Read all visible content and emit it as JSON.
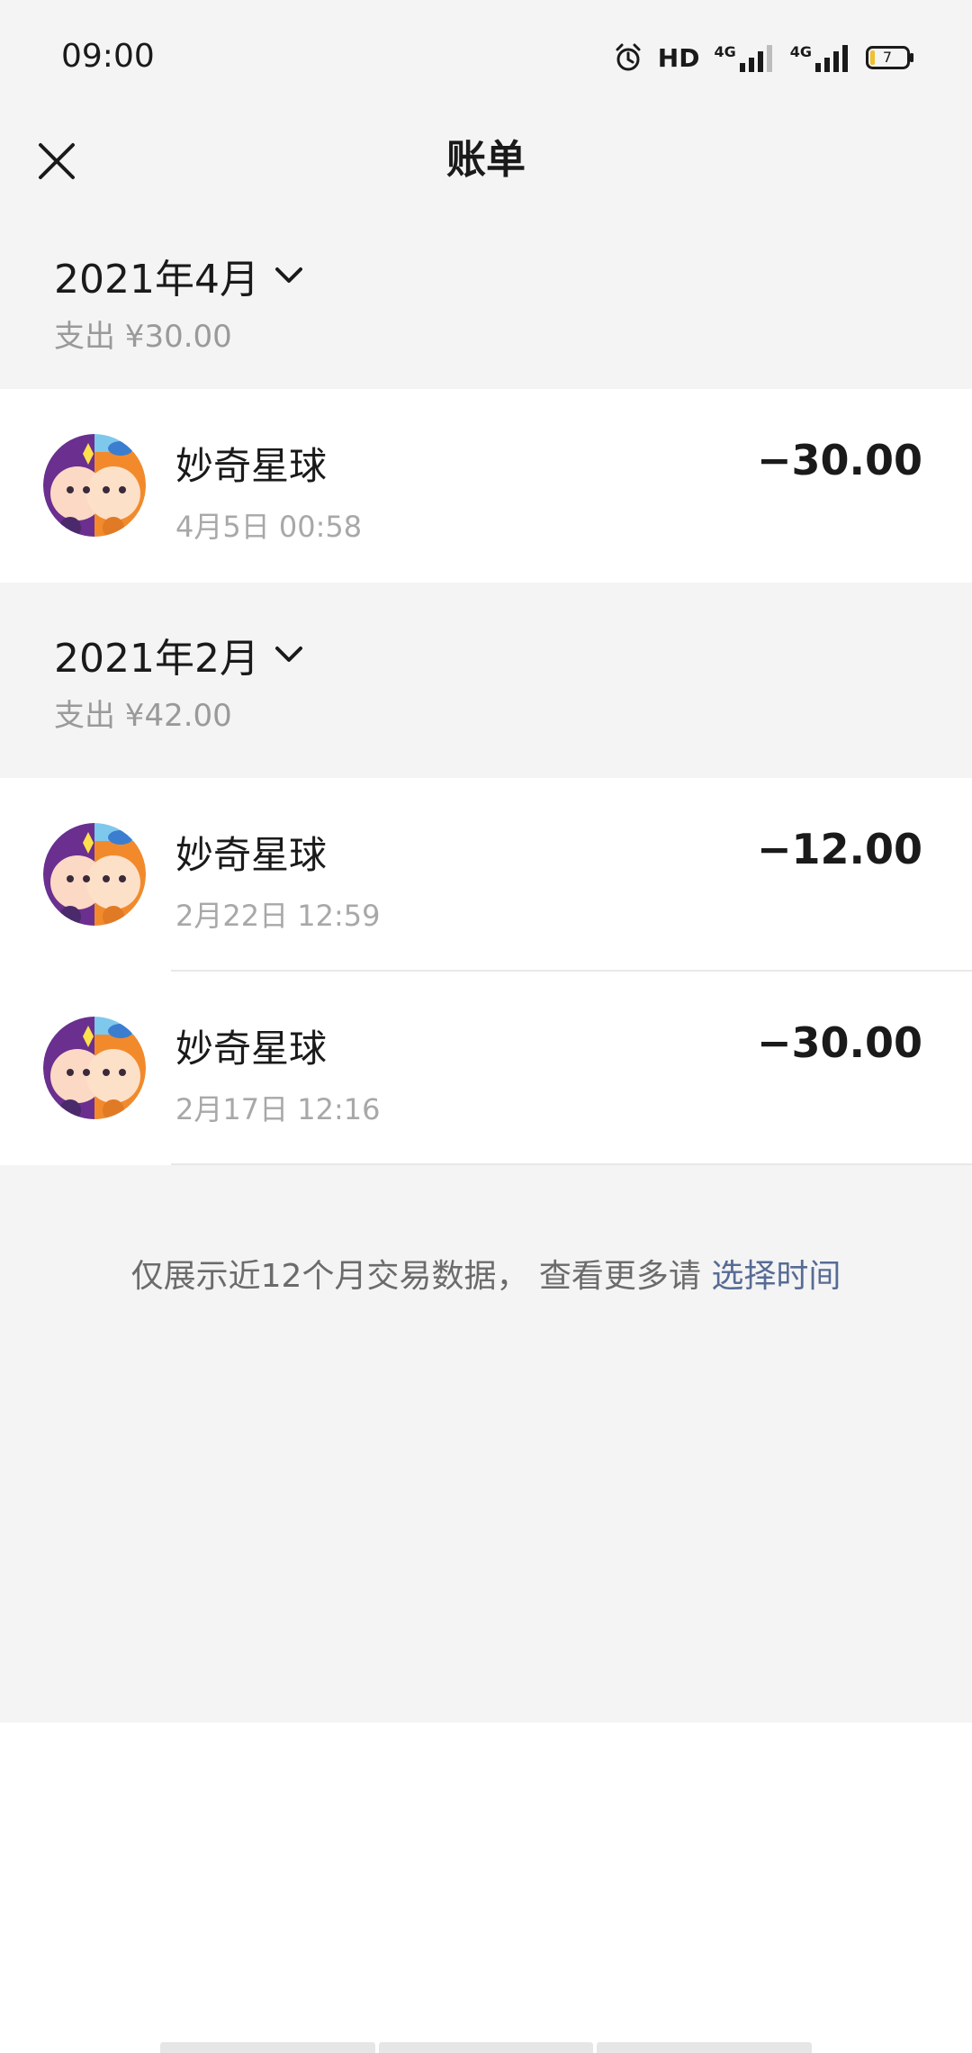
{
  "status_bar": {
    "time": "09:00",
    "network_hd": "HD",
    "network_1": "4G",
    "network_2": "4G",
    "battery": "7"
  },
  "nav": {
    "title": "账单"
  },
  "months": [
    {
      "title": "2021年4月",
      "summary": "支出 ¥30.00",
      "transactions": [
        {
          "name": "妙奇星球",
          "time": "4月5日 00:58",
          "amount": "−30.00"
        }
      ]
    },
    {
      "title": "2021年2月",
      "summary": "支出 ¥42.00",
      "transactions": [
        {
          "name": "妙奇星球",
          "time": "2月22日 12:59",
          "amount": "−12.00"
        },
        {
          "name": "妙奇星球",
          "time": "2月17日 12:16",
          "amount": "−30.00"
        }
      ]
    }
  ],
  "footer": {
    "note": "仅展示近12个月交易数据， 查看更多请 ",
    "link": "选择时间"
  },
  "colors": {
    "background": "#f4f4f4",
    "link": "#576b95",
    "secondary_text": "#9a9a9a"
  }
}
